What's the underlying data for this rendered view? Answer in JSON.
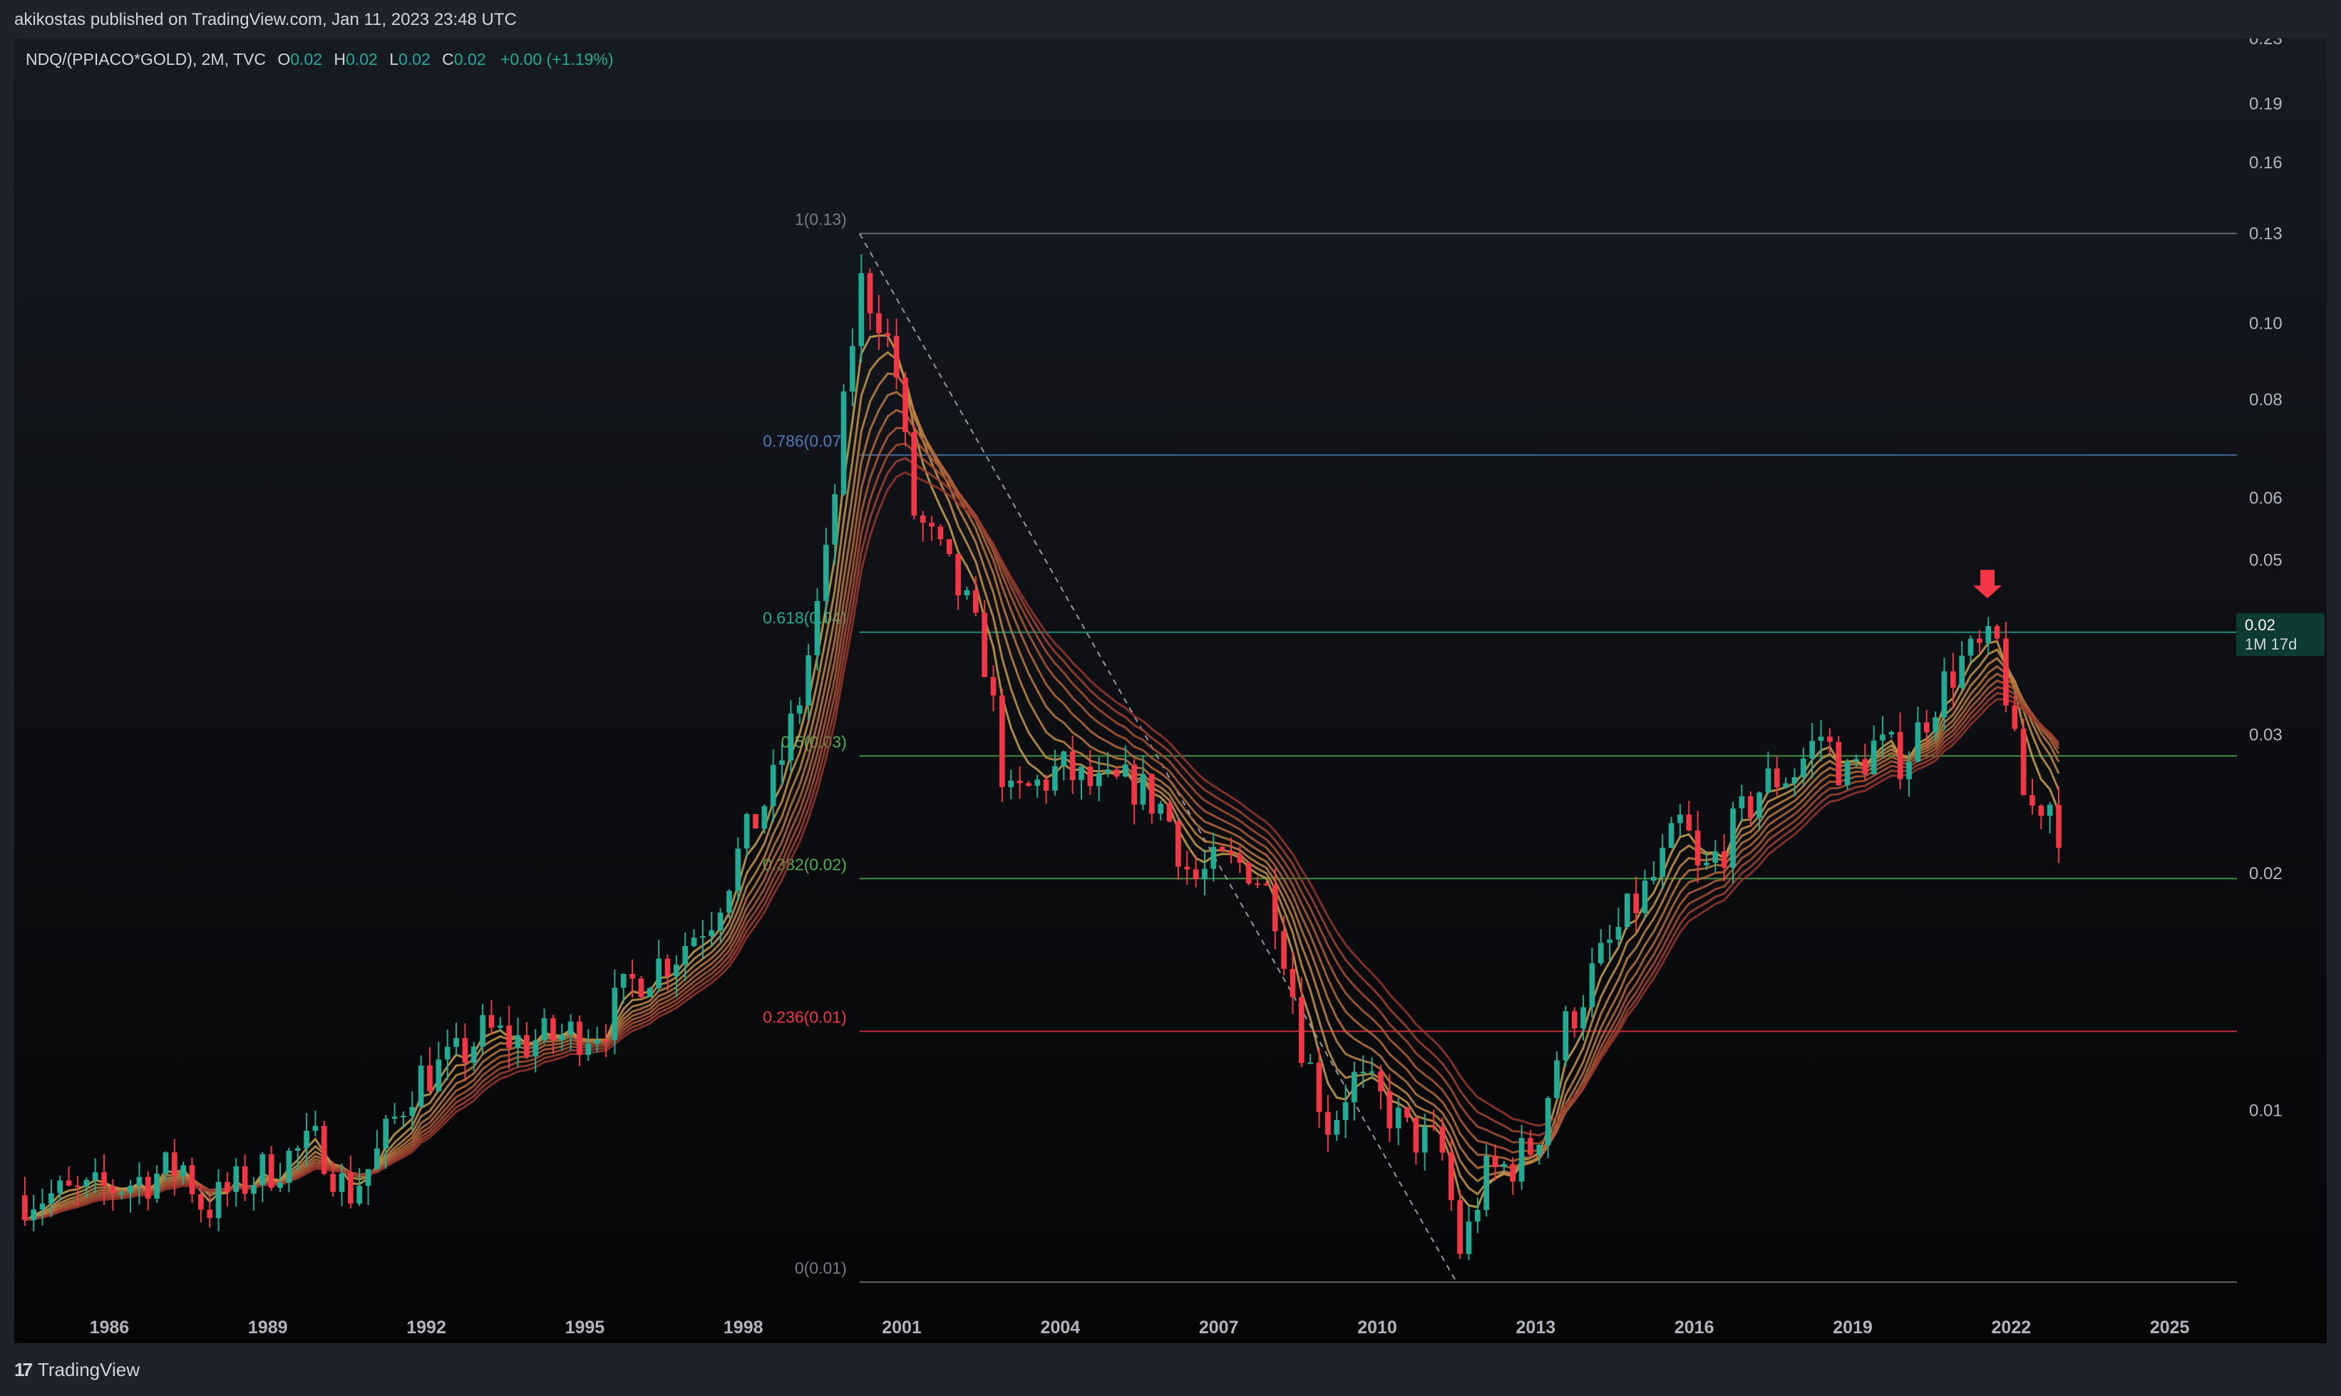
{
  "header": {
    "published": "akikostas published on TradingView.com, Jan 11, 2023 23:48 UTC"
  },
  "legend": {
    "symbol": "NDQ/(PPIACO*GOLD), 2M, TVC",
    "open_label": "O",
    "open": "0.02",
    "high_label": "H",
    "high": "0.02",
    "low_label": "L",
    "low": "0.02",
    "close_label": "C",
    "close": "0.02",
    "change": "+0.00 (+1.19%)"
  },
  "price_box": {
    "price": "0.02",
    "countdown": "1M 17d"
  },
  "footer": {
    "brand": "TradingView",
    "logo_mark": "17"
  },
  "colors": {
    "up": "#22ab94",
    "down": "#f23645",
    "arrow": "#f23645",
    "fib_1": "#787b86",
    "fib_786": "#4f7bb5",
    "fib_618": "#22ab94",
    "fib_5": "#4caf50",
    "fib_382": "#4caf50",
    "fib_236": "#f23645",
    "fib_0": "#787b86"
  },
  "chart_data": {
    "type": "candlestick",
    "symbol": "NDQ/(PPIACO*GOLD)",
    "interval": "2M",
    "yscale": "log",
    "ylim": [
      0.0055,
      0.23
    ],
    "xlim": [
      1984.2,
      2026.3
    ],
    "x_ticks": [
      "1986",
      "1989",
      "1992",
      "1995",
      "1998",
      "2001",
      "2004",
      "2007",
      "2010",
      "2013",
      "2016",
      "2019",
      "2022",
      "2025"
    ],
    "y_ticks": [
      "0.23",
      "0.19",
      "0.16",
      "0.13",
      "0.10",
      "0.08",
      "0.06",
      "0.05",
      "0.04",
      "0.03",
      "0.02",
      "0.01"
    ],
    "fib_levels": [
      {
        "label": "1(0.13)",
        "value": 0.13,
        "color": "#787b86"
      },
      {
        "label": "0.786(0.07)",
        "value": 0.068,
        "color": "#4f7bb5"
      },
      {
        "label": "0.618(0.04)",
        "value": 0.0405,
        "color": "#22ab94"
      },
      {
        "label": "0.5(0.03)",
        "value": 0.0282,
        "color": "#4caf50"
      },
      {
        "label": "0.382(0.02)",
        "value": 0.0197,
        "color": "#4caf50"
      },
      {
        "label": "0.236(0.01)",
        "value": 0.0126,
        "color": "#f23645"
      },
      {
        "label": "0(0.01)",
        "value": 0.00605,
        "color": "#787b86"
      }
    ],
    "fib_range_x": [
      2000.2,
      2026.6
    ],
    "trend_line": {
      "from": [
        2000.2,
        0.13
      ],
      "to": [
        2011.5,
        0.00605
      ]
    },
    "marker_arrow": {
      "x": 2021.55,
      "y": 0.042
    },
    "price_keys": [
      [
        1984.4,
        0.0078
      ],
      [
        1985.5,
        0.0078
      ],
      [
        1986.4,
        0.0081
      ],
      [
        1987.4,
        0.0085
      ],
      [
        1987.8,
        0.0075
      ],
      [
        1988.4,
        0.008
      ],
      [
        1989.5,
        0.0088
      ],
      [
        1990.0,
        0.0091
      ],
      [
        1990.5,
        0.0078
      ],
      [
        1991.0,
        0.0086
      ],
      [
        1991.8,
        0.011
      ],
      [
        1992.5,
        0.0115
      ],
      [
        1993.1,
        0.0126
      ],
      [
        1993.8,
        0.0122
      ],
      [
        1994.5,
        0.0124
      ],
      [
        1995.3,
        0.0128
      ],
      [
        1996.0,
        0.0148
      ],
      [
        1996.7,
        0.0158
      ],
      [
        1997.4,
        0.0178
      ],
      [
        1998.0,
        0.0218
      ],
      [
        1998.6,
        0.0262
      ],
      [
        1999.1,
        0.034
      ],
      [
        1999.6,
        0.051
      ],
      [
        2000.0,
        0.088
      ],
      [
        2000.2,
        0.113
      ],
      [
        2000.6,
        0.102
      ],
      [
        2000.9,
        0.086
      ],
      [
        2001.2,
        0.058
      ],
      [
        2001.7,
        0.051
      ],
      [
        2002.2,
        0.044
      ],
      [
        2002.6,
        0.037
      ],
      [
        2003.0,
        0.0245
      ],
      [
        2003.6,
        0.026
      ],
      [
        2004.0,
        0.0272
      ],
      [
        2004.7,
        0.0255
      ],
      [
        2005.4,
        0.026
      ],
      [
        2006.0,
        0.024
      ],
      [
        2006.5,
        0.0195
      ],
      [
        2007.0,
        0.0205
      ],
      [
        2007.6,
        0.0205
      ],
      [
        2008.1,
        0.018
      ],
      [
        2008.6,
        0.012
      ],
      [
        2009.1,
        0.0095
      ],
      [
        2009.5,
        0.011
      ],
      [
        2010.0,
        0.0104
      ],
      [
        2010.6,
        0.0093
      ],
      [
        2011.2,
        0.009
      ],
      [
        2011.6,
        0.0065
      ],
      [
        2012.0,
        0.0082
      ],
      [
        2012.6,
        0.0086
      ],
      [
        2013.0,
        0.0091
      ],
      [
        2013.5,
        0.0125
      ],
      [
        2014.1,
        0.015
      ],
      [
        2014.7,
        0.0175
      ],
      [
        2015.3,
        0.02
      ],
      [
        2015.8,
        0.0235
      ],
      [
        2016.1,
        0.0195
      ],
      [
        2016.7,
        0.0225
      ],
      [
        2017.3,
        0.026
      ],
      [
        2017.9,
        0.027
      ],
      [
        2018.4,
        0.03
      ],
      [
        2018.9,
        0.0265
      ],
      [
        2019.4,
        0.029
      ],
      [
        2020.0,
        0.028
      ],
      [
        2020.5,
        0.033
      ],
      [
        2021.0,
        0.037
      ],
      [
        2021.5,
        0.0385
      ],
      [
        2021.8,
        0.039
      ],
      [
        2022.0,
        0.03
      ],
      [
        2022.3,
        0.024
      ],
      [
        2022.7,
        0.025
      ],
      [
        2023.0,
        0.0222
      ]
    ],
    "ribbon_periods": [
      4,
      6,
      8,
      10,
      12,
      14,
      16,
      18,
      20
    ],
    "last_price": "0.02"
  }
}
